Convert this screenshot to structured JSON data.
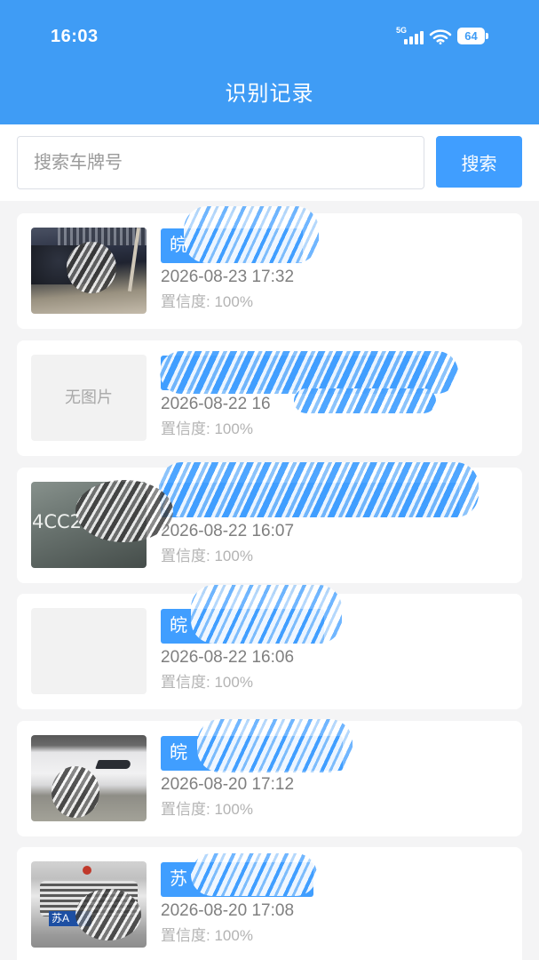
{
  "status_bar": {
    "time": "16:03",
    "network_type": "5G",
    "battery_level": "64",
    "icons": {
      "signal": "signal-icon",
      "wifi": "wifi-icon",
      "battery": "battery-icon"
    }
  },
  "header": {
    "title": "识别记录"
  },
  "search": {
    "placeholder": "搜索车牌号",
    "value": "",
    "button_label": "搜索"
  },
  "labels": {
    "confidence": "置信度:",
    "no_image": "无图片"
  },
  "colors": {
    "header": "#3f9cf5",
    "primary": "#409eff",
    "background": "#f4f4f5",
    "card": "#ffffff",
    "time_text": "#7f7f7f",
    "confidence_text": "#b3b3b3"
  },
  "records": [
    {
      "plate": "皖",
      "time": "2026-08-23 17:32",
      "confidence": "100%"
    },
    {
      "time": "2026-08-22 16",
      "confidence": "100%"
    },
    {
      "time": "2026-08-22 16:07",
      "confidence": "100%",
      "image_text": "4CC2"
    },
    {
      "plate": "皖",
      "time": "2026-08-22 16:06",
      "confidence": "100%"
    },
    {
      "plate": "皖",
      "time": "2026-08-20 17:12",
      "confidence": "100%"
    },
    {
      "plate": "苏",
      "time": "2026-08-20 17:08",
      "confidence": "100%",
      "image_text": "苏A"
    }
  ]
}
